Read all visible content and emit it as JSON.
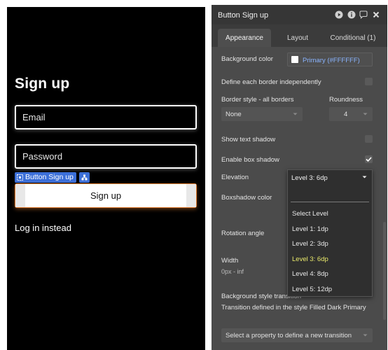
{
  "canvas": {
    "title": "Sign up",
    "email_placeholder": "Email",
    "password_placeholder": "Password",
    "selection_tag": "Button Sign up",
    "signup_button": "Sign up",
    "login_link": "Log in instead"
  },
  "panel": {
    "title": "Button Sign up",
    "header_icons": [
      "play-icon",
      "info-icon",
      "comment-icon",
      "close-icon"
    ],
    "tabs": [
      "Appearance",
      "Layout",
      "Conditional (1)"
    ],
    "active_tab": "Appearance",
    "background_color_label": "Background color",
    "background_color_value": "Primary (#FFFFFF)",
    "define_border_label": "Define each border independently",
    "border_style_label": "Border style - all borders",
    "border_style_value": "None",
    "roundness_label": "Roundness",
    "roundness_value": "4",
    "text_shadow_label": "Show text shadow",
    "text_shadow_checked": false,
    "box_shadow_label": "Enable box shadow",
    "box_shadow_checked": true,
    "elevation_label": "Elevation",
    "elevation_value": "Level 3: 6dp",
    "elevation_options": [
      "Select Level",
      "Level 1: 1dp",
      "Level 2: 3dp",
      "Level 3: 6dp",
      "Level 4: 8dp",
      "Level 5: 12dp"
    ],
    "boxshadow_color_label": "Boxshadow color",
    "rotation_label": "Rotation angle",
    "width_label": "Width",
    "width_value": "0px - inf",
    "bg_transition_label": "Background style transition",
    "transition_note": "Transition defined in the style Filled Dark Primary",
    "transition_dropdown": "Select a property to define a new transition"
  },
  "colors": {
    "canvas_bg": "#000000",
    "panel_bg": "#4b4b4b",
    "panel_header_bg": "#363636",
    "accent_blue": "#3b6fd8",
    "link_color": "#8ab4ff",
    "current_option": "#e8e86a",
    "button_glow": "#e07b2f"
  }
}
